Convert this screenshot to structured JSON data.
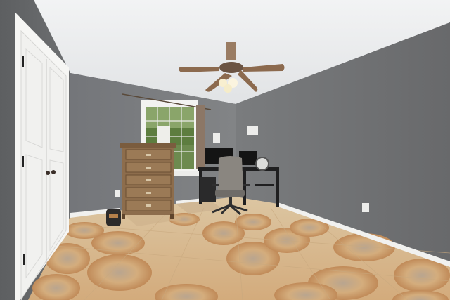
{
  "photo": {
    "subject": "",
    "colors": {
      "wall": "#7b7d7f",
      "wall_dark": "#5f6163",
      "ceiling": "#eef0f1",
      "floor_base": "#d9b98a",
      "floor_tile": "#e6cfa6",
      "medallion": "#c79a6a",
      "door": "#f4f4f2",
      "dresser": "#8a6a4a",
      "baseboard": "#f2f2f0",
      "window_green": "#5f8a4a"
    }
  }
}
